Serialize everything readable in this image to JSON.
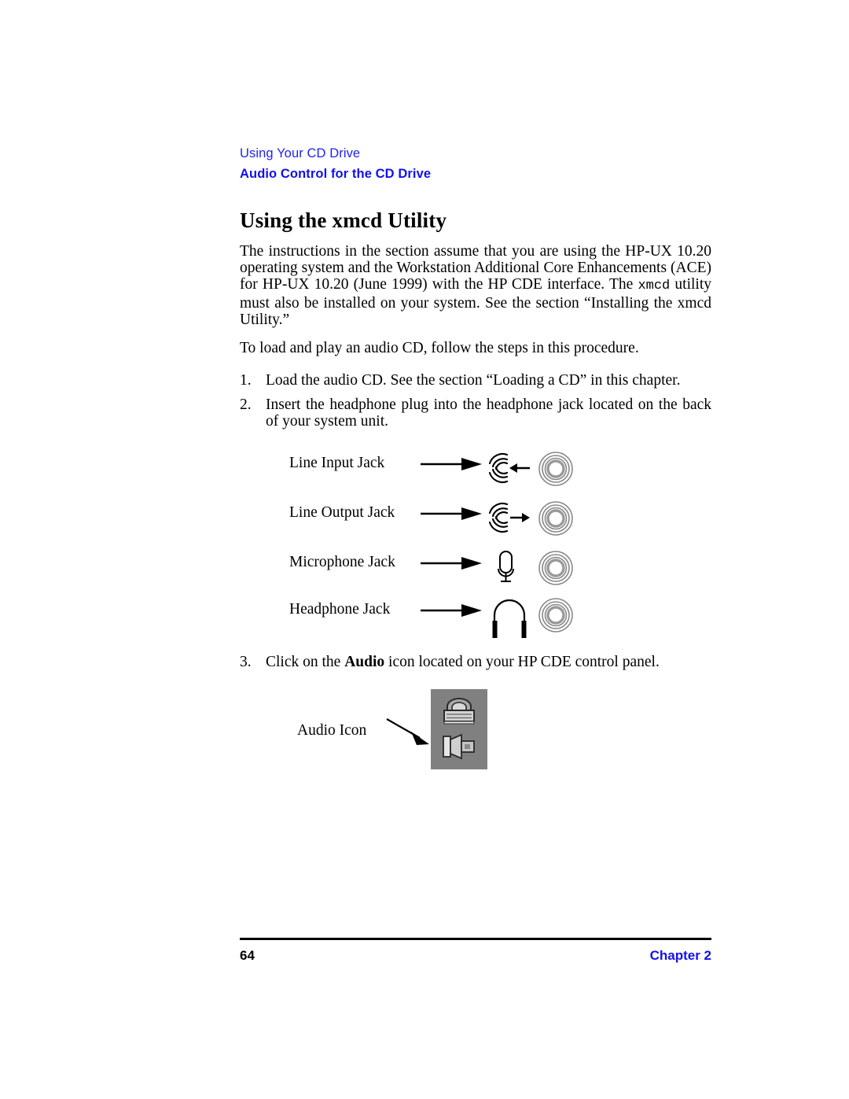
{
  "header": {
    "section": "Using Your CD Drive",
    "subsection": "Audio Control for the CD Drive",
    "color": "#1111ee"
  },
  "title": "Using the xmcd Utility",
  "intro_paragraph": {
    "part1": "The instructions in the section assume that you are using the HP-UX 10.20 operating system and the Workstation Additional Core Enhancements (ACE) for HP-UX 10.20 (June 1999) with the HP CDE interface. The ",
    "mono1": "xmcd",
    "part2": " utility must also be installed on your system. See the section “Installing the xmcd Utility.”"
  },
  "lead_in": "To load and play an audio CD, follow the steps in this procedure.",
  "steps": [
    {
      "number": "1.",
      "text": "Load the audio CD. See the section “Loading a CD” in this chapter."
    },
    {
      "number": "2.",
      "text": "Insert the headphone plug into the headphone jack located on the back of your system unit."
    },
    {
      "number": "3.",
      "pre": "Click on the ",
      "bold": "Audio",
      "post": " icon located on your HP CDE control panel."
    }
  ],
  "jack_figure": {
    "rows": [
      {
        "label": "Line Input Jack",
        "glyph": "line-input-waves-icon",
        "port": "audio-jack-port-icon"
      },
      {
        "label": "Line Output Jack",
        "glyph": "line-output-waves-icon",
        "port": "audio-jack-port-icon"
      },
      {
        "label": "Microphone Jack",
        "glyph": "microphone-icon",
        "port": "audio-jack-port-icon"
      },
      {
        "label": "Headphone Jack",
        "glyph": "headphone-icon",
        "port": "audio-jack-port-icon"
      }
    ]
  },
  "audio_figure": {
    "label": "Audio Icon",
    "panel_color": "#808080",
    "icons": [
      "cd-player-icon",
      "speaker-icon"
    ]
  },
  "footer": {
    "page_number": "64",
    "chapter": "Chapter 2",
    "chapter_color": "#1111ee"
  }
}
